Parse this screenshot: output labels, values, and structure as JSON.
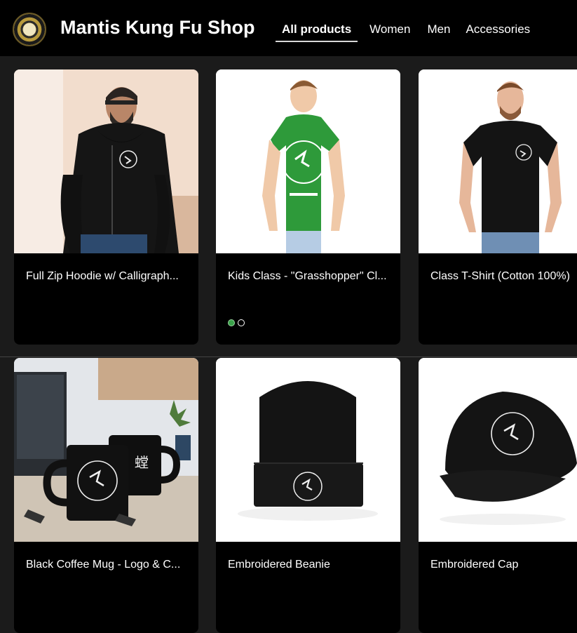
{
  "header": {
    "shop_title": "Mantis Kung Fu Shop",
    "nav": [
      "All products",
      "Women",
      "Men",
      "Accessories"
    ],
    "active_nav": "All products"
  },
  "products": [
    {
      "title": "Full Zip Hoodie w/ Calligraph...",
      "image": "black zip hoodie with logo"
    },
    {
      "title": "Kids Class - \"Grasshopper\" Cl...",
      "image": "green kids t-shirt with logo",
      "carousel_dots": 2,
      "active_dot": 1
    },
    {
      "title": "Class T-Shirt (Cotton 100%)",
      "image": "black t-shirt with logo"
    },
    {
      "title": "Black Coffee Mug - Logo & C...",
      "image": "two black coffee mugs"
    },
    {
      "title": "Embroidered Beanie",
      "image": "black beanie with logo"
    },
    {
      "title": "Embroidered Cap",
      "image": "black cap with logo"
    }
  ],
  "colors": {
    "header_bg": "#000000",
    "page_bg": "#1b1b1b",
    "dot_active": "#3aa14a"
  }
}
